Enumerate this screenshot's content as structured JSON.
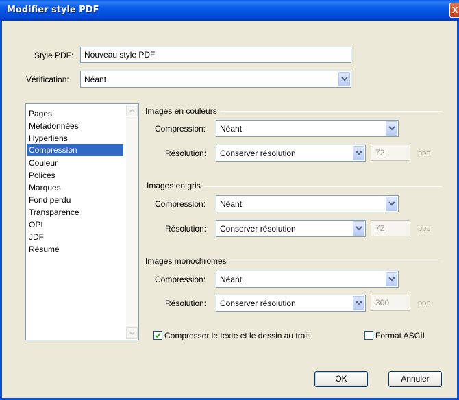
{
  "window": {
    "title": "Modifier style PDF",
    "close_glyph": "X"
  },
  "style_pdf": {
    "label": "Style PDF:",
    "value": "Nouveau style PDF"
  },
  "verification": {
    "label": "Vérification:",
    "value": "Néant"
  },
  "sidebar": {
    "items": [
      "Pages",
      "Métadonnées",
      "Hyperliens",
      "Compression",
      "Couleur",
      "Polices",
      "Marques",
      "Fond perdu",
      "Transparence",
      "OPI",
      "JDF",
      "Résumé"
    ],
    "selected_index": 3
  },
  "groups": [
    {
      "title": "Images en couleurs",
      "compression_label": "Compression:",
      "compression_value": "Néant",
      "resolution_label": "Résolution:",
      "resolution_value": "Conserver résolution",
      "ppp_value": "72",
      "unit": "ppp"
    },
    {
      "title": "Images en gris",
      "compression_label": "Compression:",
      "compression_value": "Néant",
      "resolution_label": "Résolution:",
      "resolution_value": "Conserver résolution",
      "ppp_value": "72",
      "unit": "ppp"
    },
    {
      "title": "Images monochromes",
      "compression_label": "Compression:",
      "compression_value": "Néant",
      "resolution_label": "Résolution:",
      "resolution_value": "Conserver résolution",
      "ppp_value": "300",
      "unit": "ppp"
    }
  ],
  "options": {
    "compress_text": {
      "label": "Compresser le texte et le dessin au trait",
      "checked": true
    },
    "ascii": {
      "label": "Format ASCII",
      "checked": false
    }
  },
  "buttons": {
    "ok": "OK",
    "cancel": "Annuler"
  },
  "colors": {
    "titlebar": "#0a5ee8",
    "selection": "#316ac5",
    "dialog_bg": "#ece9d8"
  }
}
